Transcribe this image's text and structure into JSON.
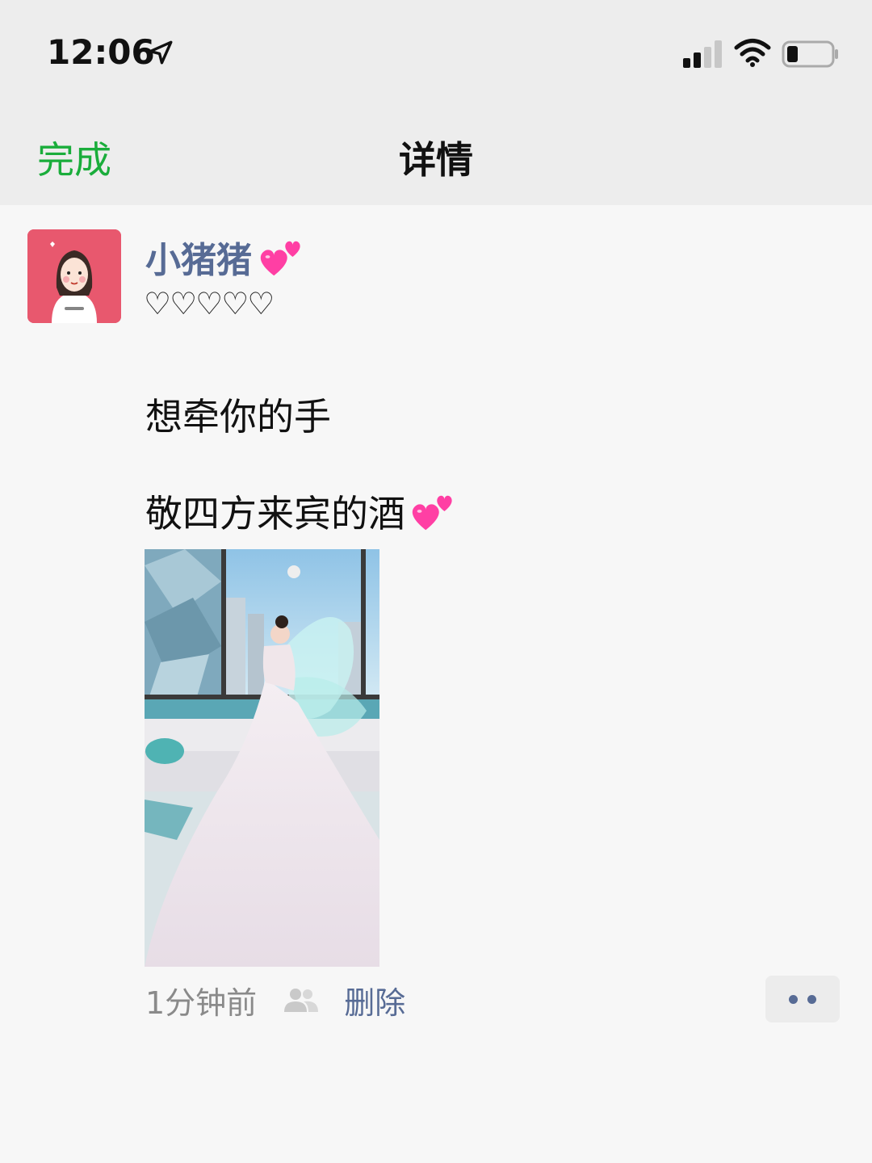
{
  "status_bar": {
    "time": "12:06"
  },
  "nav": {
    "done_label": "完成",
    "title": "详情"
  },
  "post": {
    "author": "小猪猪",
    "hearts": "♡♡♡♡♡",
    "line1": "想牵你的手",
    "line2": "敬四方来宾的酒",
    "time_ago": "1分钟前",
    "delete_label": "删除"
  },
  "colors": {
    "accent_green": "#1aad3b",
    "link_blue": "#576b95",
    "nav_bg": "#ededed",
    "page_bg": "#f7f7f7"
  },
  "icons": [
    "location-arrow-icon",
    "signal-icon",
    "wifi-icon",
    "battery-icon",
    "two-hearts-emoji",
    "people-icon",
    "more-dots-icon"
  ]
}
